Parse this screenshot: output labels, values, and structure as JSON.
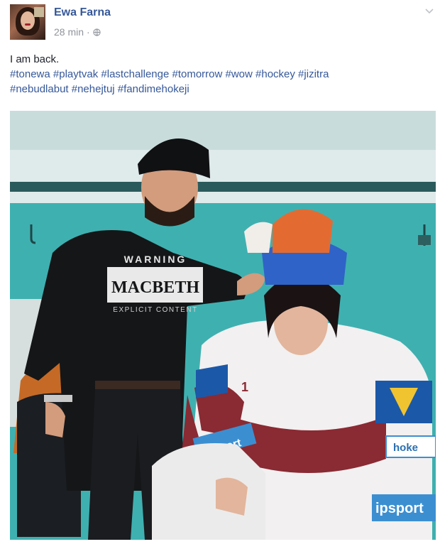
{
  "post": {
    "author": "Ewa Farna",
    "time": "28 min",
    "separator": "·",
    "text": "I am back.",
    "hashtags_line1": "#tonewa #playtvak #lastchallenge #tomorrow #wow #hockey #jizitra",
    "hashtags_line2": "#nebudlabut #nehejtuj #fandimehokeji"
  },
  "photo": {
    "shirt_line1": "WARNING",
    "shirt_line2": "MACBETH",
    "shirt_line3": "EXPLICIT CONTENT",
    "jersey_sponsor": "ipsport",
    "jersey_sponsor_arm": "ipsport",
    "jersey_hoke": "hoke",
    "jersey_number": "1"
  },
  "colors": {
    "link": "#365899",
    "meta": "#90949c",
    "wall": "#3fb0b0",
    "jersey_red": "#8a2a33"
  }
}
